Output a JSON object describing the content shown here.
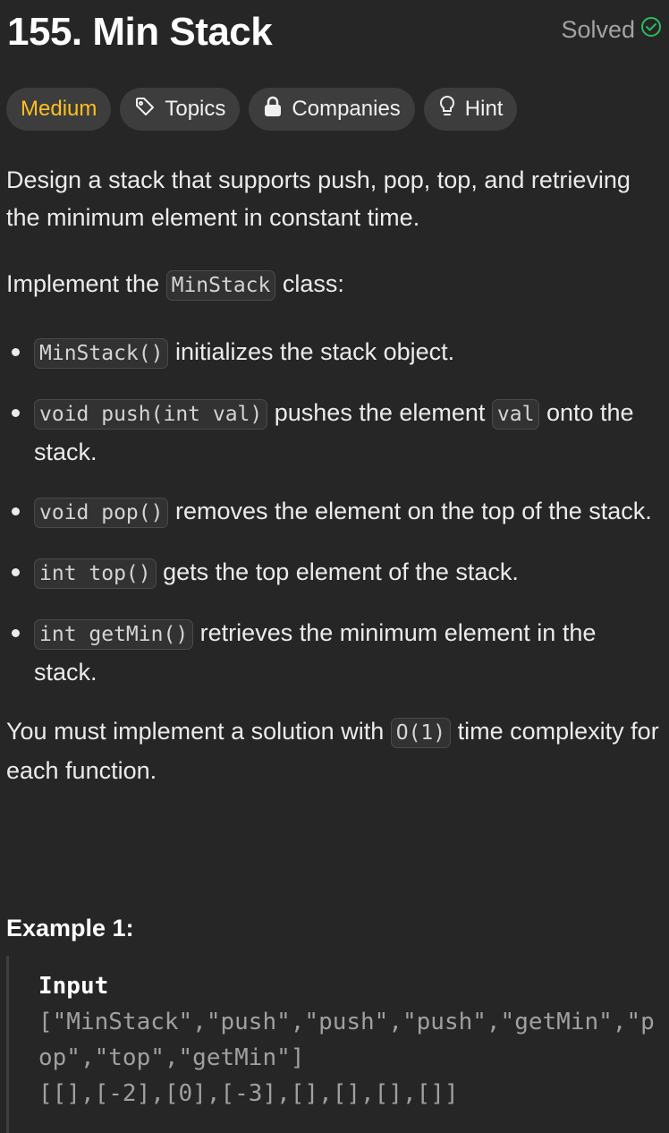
{
  "problem": {
    "title": "155. Min Stack",
    "status": "Solved"
  },
  "tags": {
    "difficulty": "Medium",
    "topics": "Topics",
    "companies": "Companies",
    "hint": "Hint"
  },
  "description": {
    "intro": "Design a stack that supports push, pop, top, and retrieving the minimum element in constant time.",
    "implement_prefix": "Implement the ",
    "class_name": "MinStack",
    "implement_suffix": " class:",
    "methods": [
      {
        "code": "MinStack()",
        "text": " initializes the stack object."
      },
      {
        "code": "void push(int val)",
        "text_before": " pushes the element ",
        "code2": "val",
        "text_after": " onto the stack."
      },
      {
        "code": "void pop()",
        "text": " removes the element on the top of the stack."
      },
      {
        "code": "int top()",
        "text": " gets the top element of the stack."
      },
      {
        "code": "int getMin()",
        "text": " retrieves the minimum element in the stack."
      }
    ],
    "complexity_prefix": "You must implement a solution with ",
    "complexity_code": "O(1)",
    "complexity_suffix": " time complexity for each function."
  },
  "example": {
    "title": "Example 1:",
    "input_label": "Input",
    "input_line1": "[\"MinStack\",\"push\",\"push\",\"push\",\"getMin\",\"pop\",\"top\",\"getMin\"]",
    "input_line2": "[[],[-2],[0],[-3],[],[],[],[]]"
  },
  "colors": {
    "background": "#262626",
    "medium": "#ffc01e",
    "solved_check": "#2cbb5d",
    "tag_bg": "#3d3d3d"
  },
  "icons": {
    "solved": "check-circle-icon",
    "topics": "tag-icon",
    "companies": "lock-icon",
    "hint": "lightbulb-icon"
  }
}
